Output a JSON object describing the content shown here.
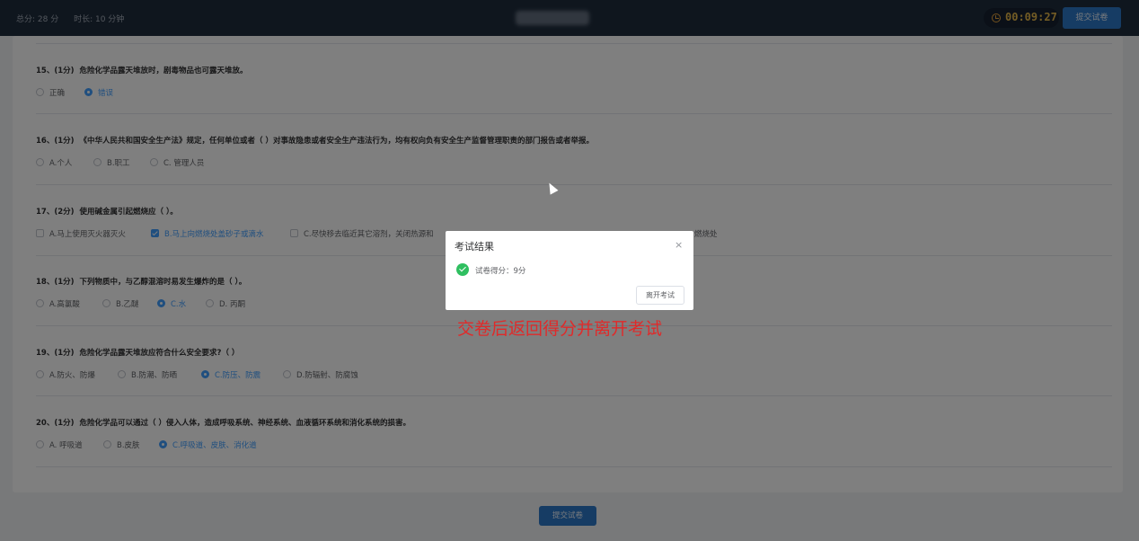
{
  "header": {
    "total_score": "总分: 28 分",
    "duration": "时长: 10 分钟",
    "timer": "00:09:27",
    "submit_label": "提交试卷"
  },
  "questions": [
    {
      "number": "15、(1分)",
      "text": "危险化学品露天堆放时，剧毒物品也可露天堆放。",
      "options": [
        {
          "label": "正确",
          "selected": false
        },
        {
          "label": "错误",
          "selected": true
        }
      ]
    },
    {
      "number": "16、(1分)",
      "text": "《中华人民共和国安全生产法》规定，任何单位或者（ ）对事故隐患或者安全生产违法行为，均有权向负有安全生产监督管理职责的部门报告或者举报。",
      "options": [
        {
          "label": "A.个人",
          "selected": false
        },
        {
          "label": "B.职工",
          "selected": false
        },
        {
          "label": "C. 管理人员",
          "selected": false
        }
      ]
    },
    {
      "number": "17、(2分)",
      "text": "使用碱金属引起燃烧应（ ）。",
      "options": [
        {
          "label": "A.马上使用灭火器灭火",
          "selected": false
        },
        {
          "label": "B.马上向燃烧处盖砂子或滴水",
          "selected": true
        },
        {
          "label": "C.尽快移去临近其它溶剂，关闭热源和",
          "selected": false
        },
        {
          "label": "燃烧处",
          "selected": false
        }
      ]
    },
    {
      "number": "18、(1分)",
      "text": "下列物质中，与乙醇混溶时易发生爆炸的是（ ）。",
      "options": [
        {
          "label": "A.高氯酸",
          "selected": false
        },
        {
          "label": "B.乙醚",
          "selected": false
        },
        {
          "label": "C.水",
          "selected": true
        },
        {
          "label": "D. 丙酮",
          "selected": false
        }
      ]
    },
    {
      "number": "19、(1分)",
      "text": "危险化学品露天堆放应符合什么安全要求?（ ）",
      "options": [
        {
          "label": "A.防火、防爆",
          "selected": false
        },
        {
          "label": "B.防潮、防晒",
          "selected": false
        },
        {
          "label": "C.防压、防震",
          "selected": true
        },
        {
          "label": "D.防辐射、防腐蚀",
          "selected": false
        }
      ]
    },
    {
      "number": "20、(1分)",
      "text": "危险化学品可以通过（ ）侵入人体，造成呼吸系统、神经系统、血液循环系统和消化系统的损害。",
      "options": [
        {
          "label": "A. 呼吸道",
          "selected": false
        },
        {
          "label": "B.皮肤",
          "selected": false
        },
        {
          "label": "C.呼吸道、皮肤、消化道",
          "selected": true
        }
      ]
    }
  ],
  "footer": {
    "submit_label": "提交试卷"
  },
  "dialog": {
    "title": "考试结果",
    "close": "×",
    "message": "试卷得分：9分",
    "leave_label": "离开考试"
  },
  "annotation": "交卷后返回得分并离开考试"
}
